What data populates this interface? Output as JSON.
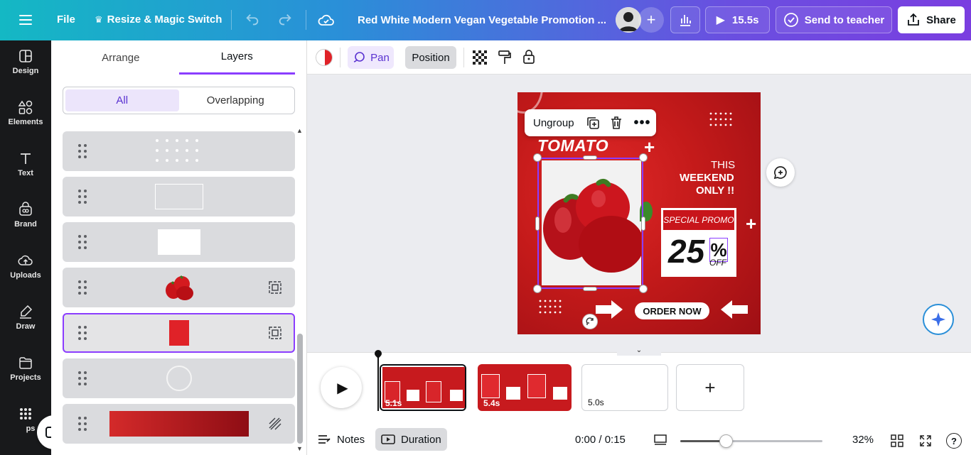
{
  "topbar": {
    "file": "File",
    "resize": "Resize & Magic Switch",
    "doc_title": "Red White Modern Vegan Vegetable Promotion ...",
    "play_time": "15.5s",
    "send_teacher": "Send to teacher",
    "share": "Share"
  },
  "sidebar": {
    "items": [
      {
        "label": "Design"
      },
      {
        "label": "Elements"
      },
      {
        "label": "Text"
      },
      {
        "label": "Brand"
      },
      {
        "label": "Uploads"
      },
      {
        "label": "Draw"
      },
      {
        "label": "Projects"
      },
      {
        "label": "ps"
      }
    ]
  },
  "panel": {
    "tabs": [
      "Arrange",
      "Layers"
    ],
    "segment": [
      "All",
      "Overlapping"
    ]
  },
  "toolbar2": {
    "pan": "Pan",
    "position": "Position"
  },
  "context_menu": {
    "ungroup": "Ungroup"
  },
  "design": {
    "heading": "TOMATO",
    "this": "THIS",
    "weekend": "WEEKEND",
    "only": "ONLY !!",
    "special": "SPECIAL PROMO",
    "discount": "25",
    "percent": "%",
    "off": "OFF",
    "order": "ORDER NOW"
  },
  "timeline": {
    "pages": [
      {
        "duration": "5.1s"
      },
      {
        "duration": "5.4s"
      },
      {
        "duration": "5.0s"
      }
    ]
  },
  "status": {
    "notes": "Notes",
    "duration": "Duration",
    "time": "0:00 / 0:15",
    "zoom": "32%",
    "zoom_level": 0.32
  },
  "colors": {
    "accent": "#8b3dff",
    "brand_red": "#d61f1f"
  }
}
